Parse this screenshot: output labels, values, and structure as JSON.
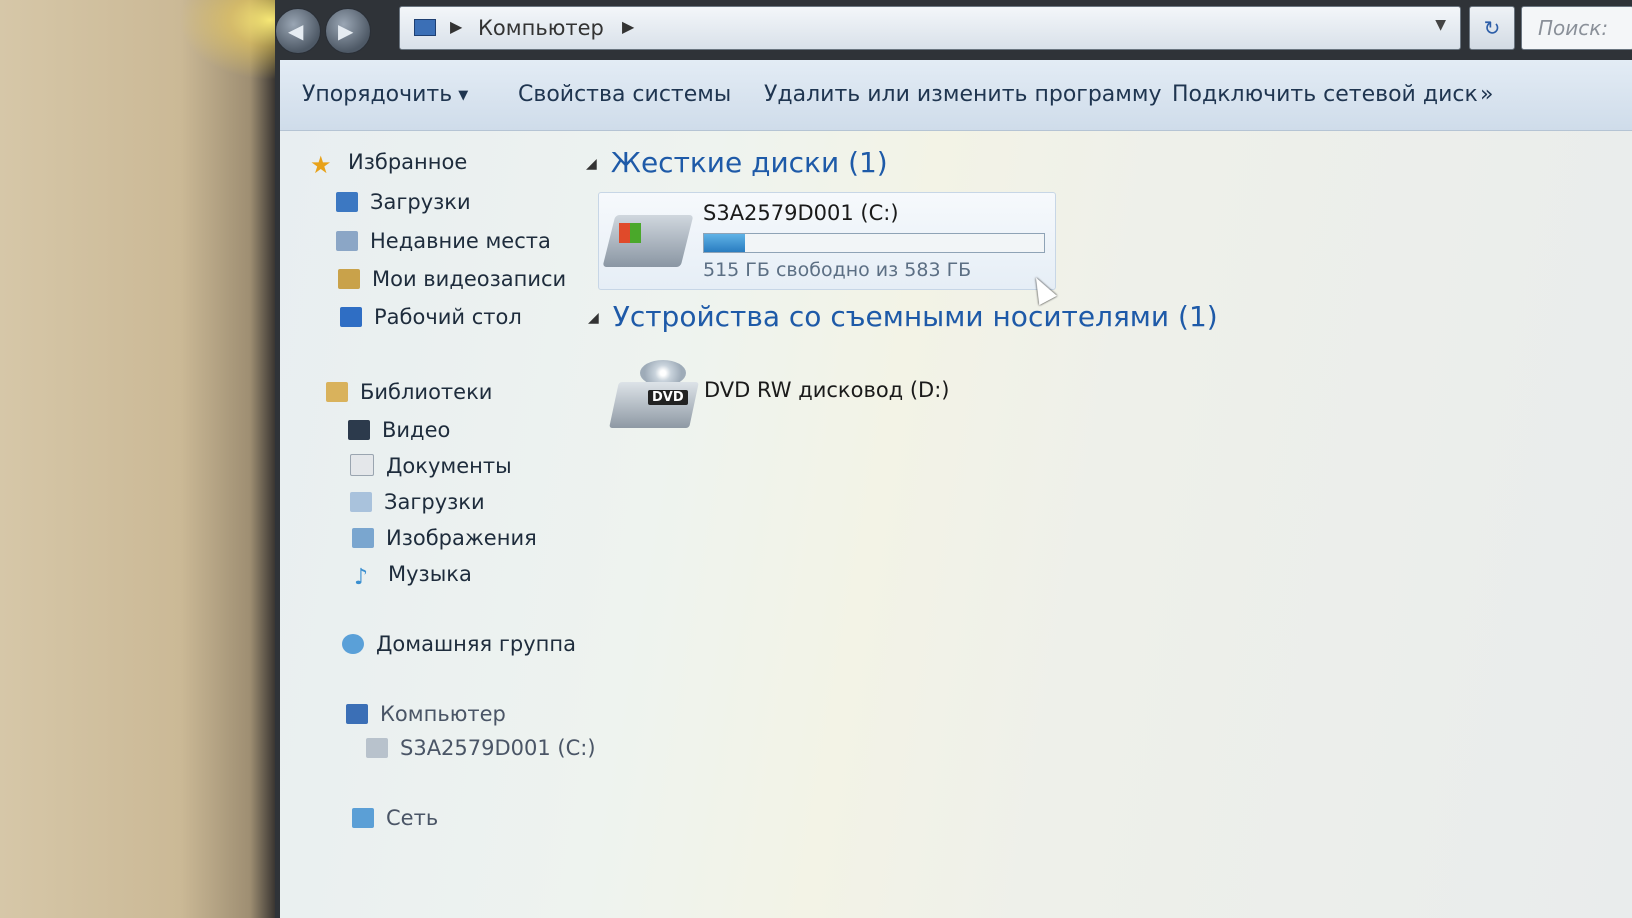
{
  "address_bar": {
    "crumb": "Компьютер"
  },
  "search": {
    "placeholder": "Поиск:"
  },
  "toolbar": {
    "organize": "Упорядочить",
    "system_properties": "Свойства системы",
    "uninstall": "Удалить или изменить программу",
    "map_drive": "Подключить сетевой диск",
    "more": "»"
  },
  "nav": {
    "favorites": "Избранное",
    "downloads": "Загрузки",
    "recent": "Недавние места",
    "my_videos": "Мои видеозаписи",
    "desktop": "Рабочий стол",
    "libraries": "Библиотеки",
    "video": "Видео",
    "documents": "Документы",
    "lib_downloads": "Загрузки",
    "images": "Изображения",
    "music": "Музыка",
    "homegroup": "Домашняя группа",
    "computer": "Компьютер",
    "computer_c": "S3A2579D001 (C:)",
    "network": "Сеть"
  },
  "content": {
    "hard_disks_header": "Жесткие диски (1)",
    "removable_header": "Устройства со съемными носителями (1)",
    "drive_c": {
      "name": "S3A2579D001 (C:)",
      "free_text": "515 ГБ свободно из 583 ГБ",
      "used_fraction": 0.12
    },
    "dvd": {
      "badge": "DVD",
      "name": "DVD RW дисковод (D:)"
    }
  }
}
